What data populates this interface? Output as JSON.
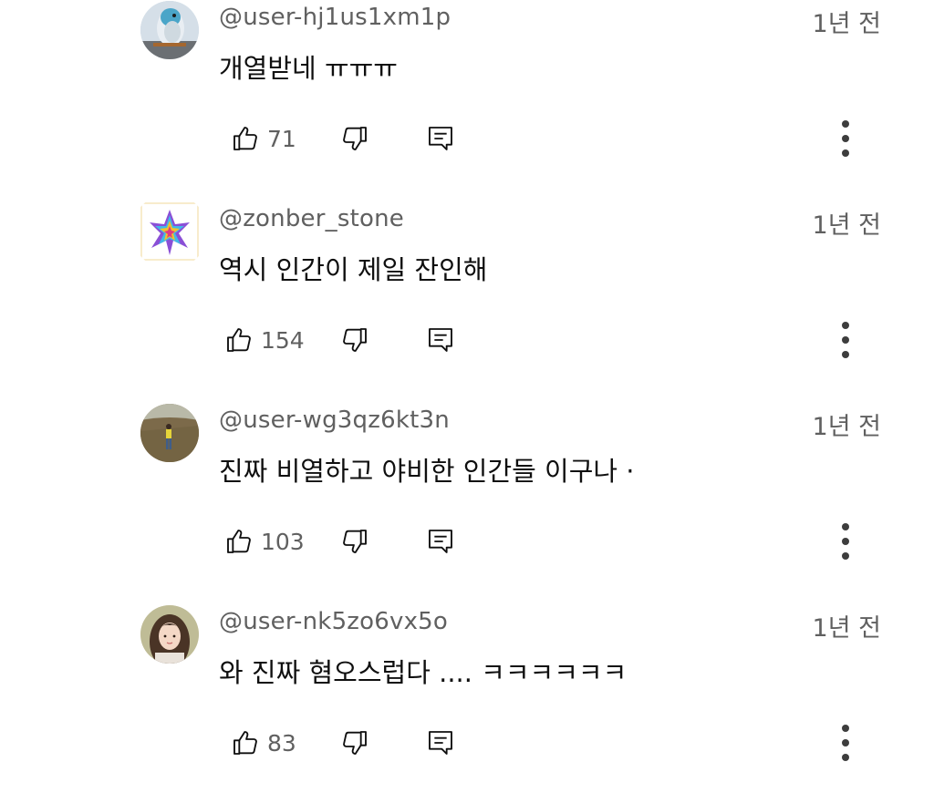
{
  "comments": [
    {
      "author": "@user-hj1us1xm1p",
      "time": "1년 전",
      "text": "개열받네 ㅠㅠㅠ",
      "likes": "71",
      "avatar_icon": "bird-avatar"
    },
    {
      "author": "@zonber_stone",
      "time": "1년 전",
      "text": "역시 인간이 제일 잔인해",
      "likes": "154",
      "avatar_icon": "rainbow-star-avatar"
    },
    {
      "author": "@user-wg3qz6kt3n",
      "time": "1년 전",
      "text": "진짜 비열하고 야비한 인간들 이구나  ·",
      "likes": "103",
      "avatar_icon": "field-person-avatar"
    },
    {
      "author": "@user-nk5zo6vx5o",
      "time": "1년 전",
      "text": "와 진짜 혐오스럽다 .... ㅋㅋㅋㅋㅋㅋ",
      "likes": "83",
      "avatar_icon": "woman-portrait-avatar"
    }
  ],
  "icons": {
    "like": "thumb-up-icon",
    "dislike": "thumb-down-icon",
    "reply": "reply-icon",
    "more": "more-vertical-icon"
  },
  "colors": {
    "secondary_text": "#606060",
    "primary_text": "#0f0f0f",
    "background": "#ffffff"
  }
}
